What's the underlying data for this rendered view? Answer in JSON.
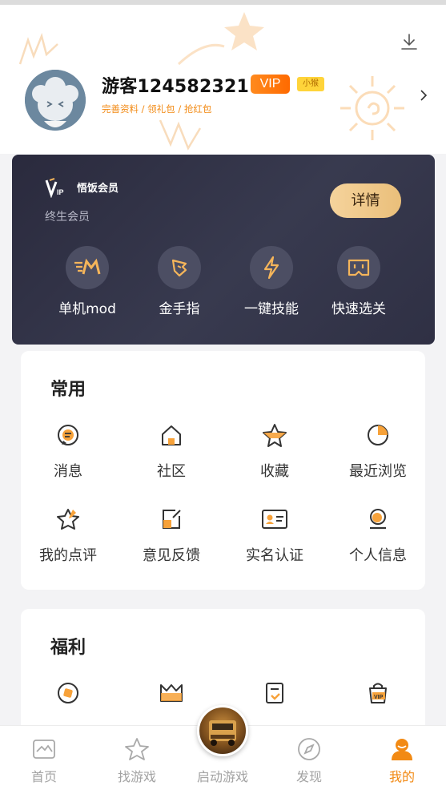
{
  "profile": {
    "username": "游客124582321",
    "vip_label": "VIP",
    "tag_label": "小猴",
    "links": "完善资料 / 领礼包 / 抢红包"
  },
  "vip_card": {
    "logo_text": "VIP",
    "title": "悟饭会员",
    "subtitle": "终生会员",
    "detail_button": "详情",
    "perks": [
      {
        "label": "单机mod",
        "icon": "mod-icon"
      },
      {
        "label": "金手指",
        "icon": "golden-finger-icon"
      },
      {
        "label": "一键技能",
        "icon": "lightning-icon"
      },
      {
        "label": "快速选关",
        "icon": "level-select-icon"
      }
    ]
  },
  "common": {
    "title": "常用",
    "items": [
      {
        "label": "消息",
        "icon": "message-icon"
      },
      {
        "label": "社区",
        "icon": "community-icon"
      },
      {
        "label": "收藏",
        "icon": "favorite-star-icon"
      },
      {
        "label": "最近浏览",
        "icon": "recent-icon"
      },
      {
        "label": "我的点评",
        "icon": "review-star-icon"
      },
      {
        "label": "意见反馈",
        "icon": "feedback-icon"
      },
      {
        "label": "实名认证",
        "icon": "id-card-icon"
      },
      {
        "label": "个人信息",
        "icon": "personal-info-icon"
      }
    ]
  },
  "welfare": {
    "title": "福利"
  },
  "tabbar": {
    "tabs": [
      {
        "label": "首页",
        "icon": "home-icon"
      },
      {
        "label": "找游戏",
        "icon": "star-icon"
      },
      {
        "label": "启动游戏",
        "icon": "launch-game-icon"
      },
      {
        "label": "发现",
        "icon": "compass-icon"
      },
      {
        "label": "我的",
        "icon": "user-icon"
      }
    ],
    "active": "我的"
  },
  "colors": {
    "accent": "#f28a14",
    "vip_card_bg": "#2f3044",
    "detail_button": "#eec488"
  }
}
